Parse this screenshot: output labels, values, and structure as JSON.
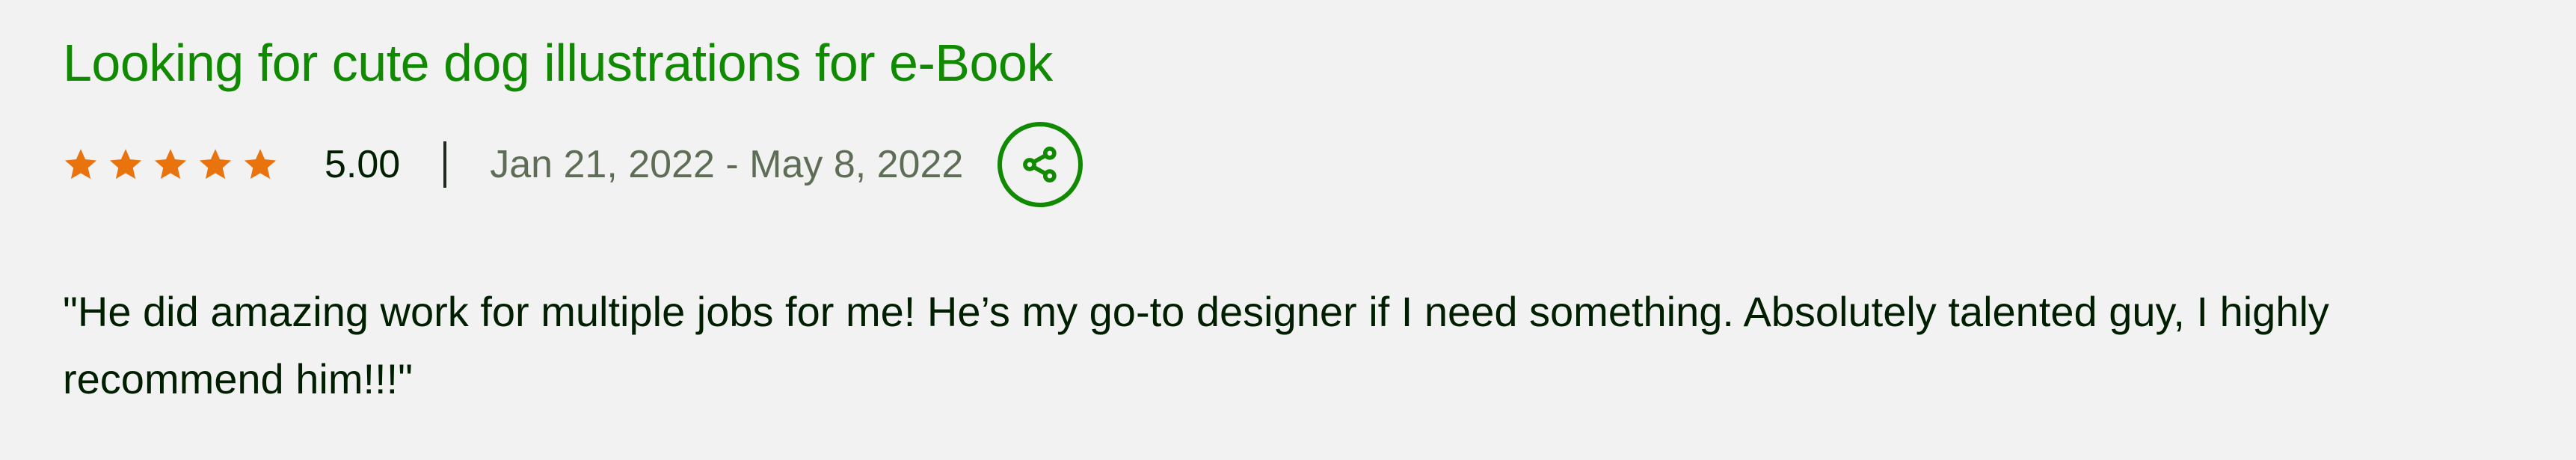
{
  "review": {
    "title": "Looking for cute dog illustrations for e-Book",
    "rating": "5.00",
    "rating_value": 5,
    "rating_max": 5,
    "date_range": "Jan 21, 2022 - May 8, 2022",
    "quote": "\"He did amazing work for multiple jobs for me! He’s my go-to designer if I need something. Absolutely talented guy, I highly recommend him!!!\""
  },
  "icons": {
    "star": "star-icon",
    "share": "share-icon"
  },
  "colors": {
    "title": "#108a00",
    "star": "#e9730c",
    "share": "#108a00",
    "text": "#001e00",
    "muted": "#5e6d55",
    "background": "#f2f2f2"
  }
}
